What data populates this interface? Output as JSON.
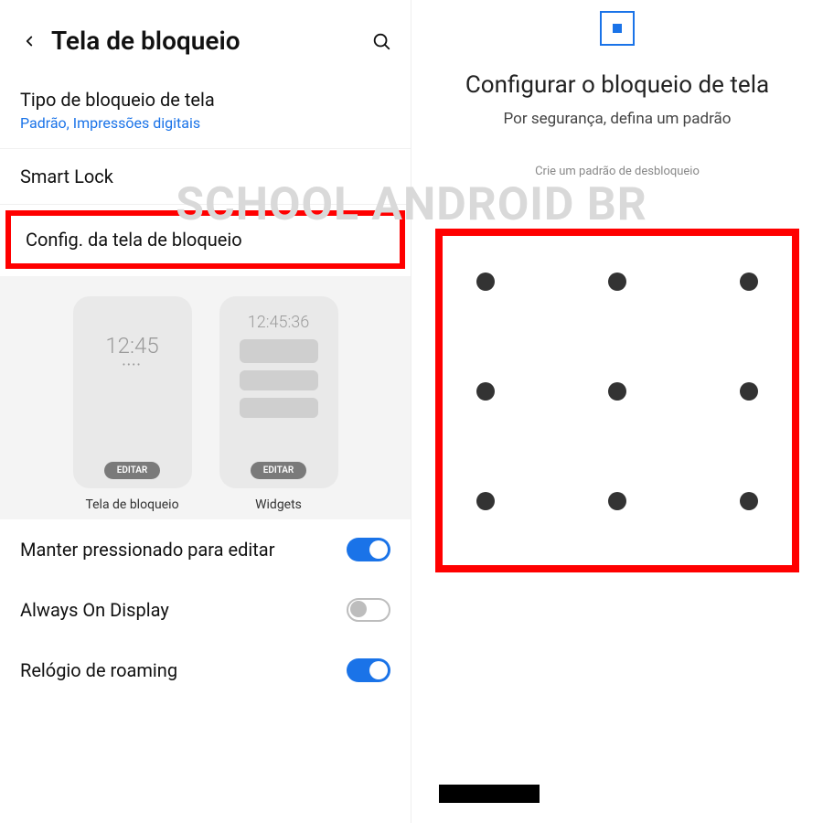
{
  "watermark": "SCHOOL ANDROID BR",
  "left": {
    "title": "Tela de bloqueio",
    "tipo": {
      "label": "Tipo de bloqueio de tela",
      "sub": "Padrão, Impressões digitais"
    },
    "smart_lock": "Smart Lock",
    "config": "Config. da tela de bloqueio",
    "preview": {
      "clock1": "12:45",
      "clock2": "12:45:36",
      "edit": "EDITAR",
      "label1": "Tela de bloqueio",
      "label2": "Widgets"
    },
    "toggles": {
      "press_hold": {
        "label": "Manter pressionado para editar",
        "on": true
      },
      "aod": {
        "label": "Always On Display",
        "on": false
      },
      "roaming": {
        "label": "Relógio de roaming",
        "on": true
      }
    }
  },
  "right": {
    "heading": "Configurar o bloqueio de tela",
    "sub": "Por segurança, defina um padrão",
    "hint": "Crie um padrão de desbloqueio"
  }
}
